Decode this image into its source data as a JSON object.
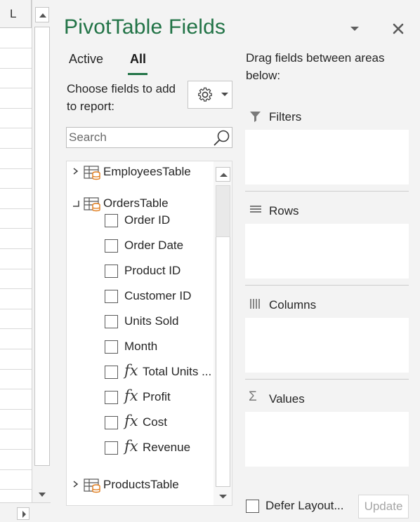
{
  "sheet": {
    "column_header": "L",
    "row_count": 23
  },
  "pane": {
    "title": "PivotTable Fields",
    "options_icon": "chevron-down-icon",
    "close_icon": "close-icon"
  },
  "tabs": [
    {
      "label": "Active",
      "selected": false
    },
    {
      "label": "All",
      "selected": true
    }
  ],
  "choose_fields_label": "Choose fields to add to report:",
  "tools_button": {
    "icon": "gear-icon",
    "dropdown_icon": "chevron-down-icon"
  },
  "search": {
    "placeholder": "Search",
    "value": ""
  },
  "field_list": {
    "tables": [
      {
        "name": "EmployeesTable",
        "expanded": false
      },
      {
        "name": "OrdersTable",
        "expanded": true
      },
      {
        "name": "ProductsTable",
        "expanded": false
      }
    ],
    "orders_fields": [
      {
        "label": "Order ID",
        "calculated": false,
        "checked": false
      },
      {
        "label": "Order Date",
        "calculated": false,
        "checked": false
      },
      {
        "label": "Product ID",
        "calculated": false,
        "checked": false
      },
      {
        "label": "Customer ID",
        "calculated": false,
        "checked": false
      },
      {
        "label": "Units Sold",
        "calculated": false,
        "checked": false
      },
      {
        "label": "Month",
        "calculated": false,
        "checked": false
      },
      {
        "label": "Total Units ...",
        "calculated": true,
        "checked": false
      },
      {
        "label": "Profit",
        "calculated": true,
        "checked": false
      },
      {
        "label": "Cost",
        "calculated": true,
        "checked": false
      },
      {
        "label": "Revenue",
        "calculated": true,
        "checked": false
      }
    ],
    "fx_symbol": "fx"
  },
  "areas": {
    "hint": "Drag fields between areas below:",
    "filters": {
      "label": "Filters",
      "icon": "filter-icon"
    },
    "rows": {
      "label": "Rows",
      "icon": "rows-icon"
    },
    "columns": {
      "label": "Columns",
      "icon": "columns-icon"
    },
    "values": {
      "label": "Values",
      "icon": "sigma-icon",
      "symbol": "Σ"
    }
  },
  "footer": {
    "defer_label": "Defer Layout...",
    "defer_checked": false,
    "update_label": "Update",
    "update_enabled": false
  },
  "colors": {
    "accent": "#217346",
    "table_icon": "#e07b1a"
  }
}
